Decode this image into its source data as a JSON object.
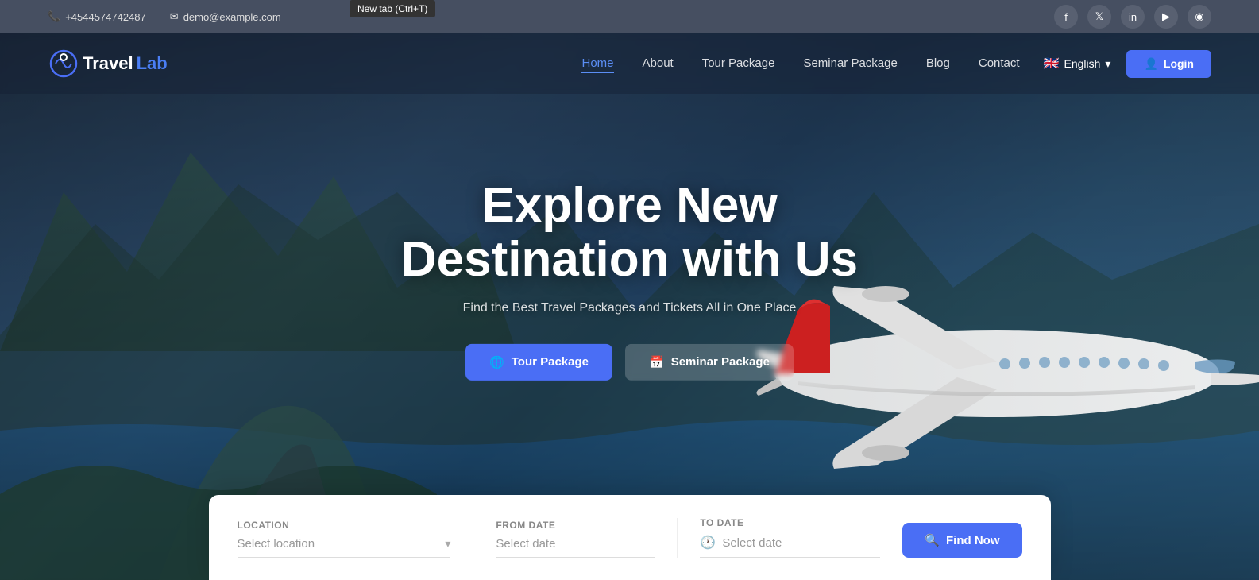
{
  "topbar": {
    "phone": "+4544574742487",
    "email": "demo@example.com",
    "phone_icon": "📞",
    "email_icon": "✉"
  },
  "tooltip": {
    "text": "New tab (Ctrl+T)"
  },
  "social": [
    {
      "name": "facebook",
      "icon": "f"
    },
    {
      "name": "twitter",
      "icon": "t"
    },
    {
      "name": "linkedin",
      "icon": "in"
    },
    {
      "name": "youtube",
      "icon": "▶"
    },
    {
      "name": "instagram",
      "icon": "◉"
    }
  ],
  "navbar": {
    "logo_white": "Travel",
    "logo_blue": "Lab",
    "links": [
      {
        "label": "Home",
        "active": true
      },
      {
        "label": "About",
        "active": false
      },
      {
        "label": "Tour Package",
        "active": false
      },
      {
        "label": "Seminar Package",
        "active": false
      },
      {
        "label": "Blog",
        "active": false
      },
      {
        "label": "Contact",
        "active": false
      }
    ],
    "language": "English",
    "login_label": "Login"
  },
  "hero": {
    "title_line1": "Explore New",
    "title_line2": "Destination with Us",
    "subtitle": "Find the Best Travel Packages and Tickets All in One Place",
    "btn_tour": "Tour Package",
    "btn_seminar": "Seminar Package",
    "btn_tour_icon": "🌐",
    "btn_seminar_icon": "📅"
  },
  "search": {
    "location_label": "Location",
    "location_placeholder": "Select location",
    "from_date_label": "From Date",
    "from_date_placeholder": "Select date",
    "to_date_label": "To Date",
    "to_date_placeholder": "Select date",
    "find_btn": "Find Now",
    "find_icon": "🔍"
  }
}
